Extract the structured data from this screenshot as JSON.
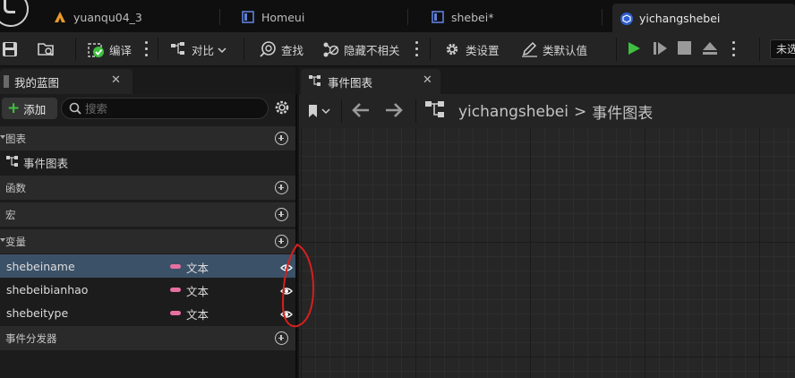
{
  "tabs": [
    {
      "label": "yuanqu04_3",
      "icon": "level-icon",
      "active": false
    },
    {
      "label": "Homeui",
      "icon": "widget-blueprint-icon",
      "active": false
    },
    {
      "label": "shebei*",
      "icon": "widget-blueprint-icon",
      "active": false
    },
    {
      "label": "yichangshebei",
      "icon": "blueprint-class-icon",
      "active": true
    }
  ],
  "toolbar": {
    "compile_label": "编译",
    "diff_label": "对比",
    "find_label": "查找",
    "hide_unrelated_label": "隐藏不相关",
    "class_settings_label": "类设置",
    "class_defaults_label": "类默认值",
    "truncated_label": "未选"
  },
  "my_blueprint": {
    "tab_label": "我的蓝图",
    "add_label": "添加",
    "search_placeholder": "搜索",
    "sections": {
      "graphs": "图表",
      "functions": "函数",
      "macros": "宏",
      "variables": "变量",
      "event_dispatchers": "事件分发器"
    },
    "graph_item": "事件图表",
    "variables": [
      {
        "name": "shebeiname",
        "type": "文本",
        "selected": true
      },
      {
        "name": "shebeibianhao",
        "type": "文本",
        "selected": false
      },
      {
        "name": "shebeitype",
        "type": "文本",
        "selected": false
      }
    ]
  },
  "graph_editor": {
    "tab_label": "事件图表",
    "breadcrumb_root": "yichangshebei",
    "breadcrumb_separator": ">",
    "breadcrumb_current": "事件图表"
  },
  "colors": {
    "play_green": "#3fbf3f",
    "text_pin_pink": "#e86fa2",
    "selection_blue": "#3b5167",
    "annotation_red": "#d61f1f"
  }
}
